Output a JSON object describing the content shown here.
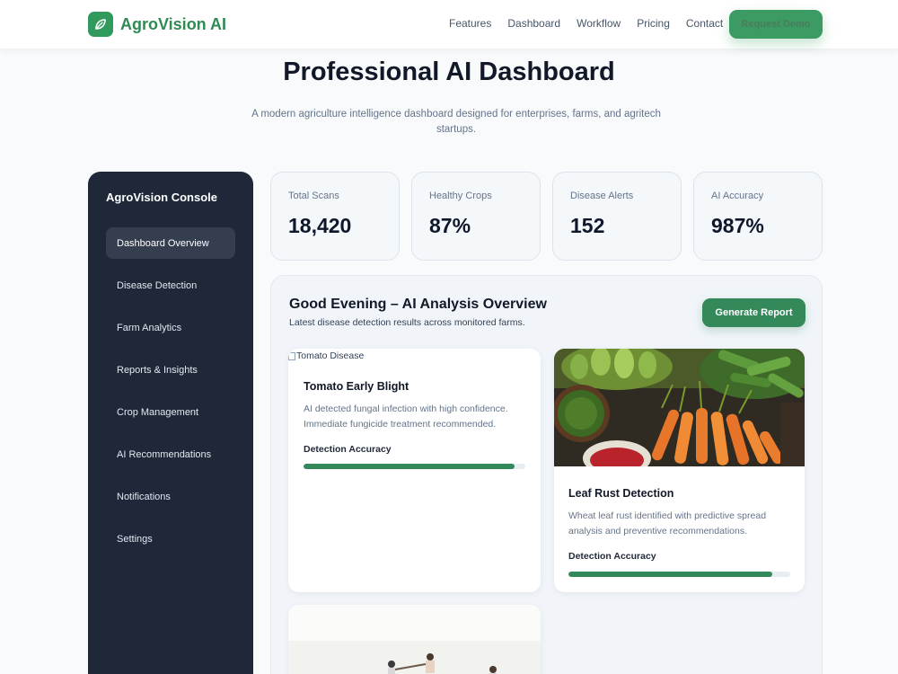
{
  "brand": {
    "name": "AgroVision AI",
    "icon": "leaf-icon"
  },
  "nav": [
    "Features",
    "Dashboard",
    "Workflow",
    "Pricing",
    "Contact"
  ],
  "cta": "Request Demo",
  "hero": {
    "title": "Professional AI Dashboard",
    "subtitle": "A modern agriculture intelligence dashboard designed for enterprises, farms, and agritech startups."
  },
  "sidebar": {
    "title": "AgroVision Console",
    "items": [
      "Dashboard Overview",
      "Disease Detection",
      "Farm Analytics",
      "Reports & Insights",
      "Crop Management",
      "AI Recommendations",
      "Notifications",
      "Settings"
    ],
    "active_index": 0
  },
  "stats": [
    {
      "label": "Total Scans",
      "value": "18,420"
    },
    {
      "label": "Healthy Crops",
      "value": "87%"
    },
    {
      "label": "Disease Alerts",
      "value": "152"
    },
    {
      "label": "AI Accuracy",
      "value": "987%"
    }
  ],
  "panel": {
    "title": "Good Evening – AI Analysis Overview",
    "subtitle": "Latest disease detection results across monitored farms.",
    "button": "Generate Report"
  },
  "cards": [
    {
      "image_alt": "Tomato Disease",
      "title": "Tomato Early Blight",
      "description": "AI detected fungal infection with high confidence. Immediate fungicide treatment recommended.",
      "accuracy_label": "Detection Accuracy",
      "accuracy": 0.95
    },
    {
      "title": "Leaf Rust Detection",
      "description": "Wheat leaf rust identified with predictive spread analysis and preventive recommendations.",
      "accuracy_label": "Detection Accuracy",
      "accuracy": 0.92
    }
  ],
  "colors": {
    "accent": "#34895a",
    "brand": "#2f8a53",
    "sidebar_bg": "#1e2838"
  }
}
